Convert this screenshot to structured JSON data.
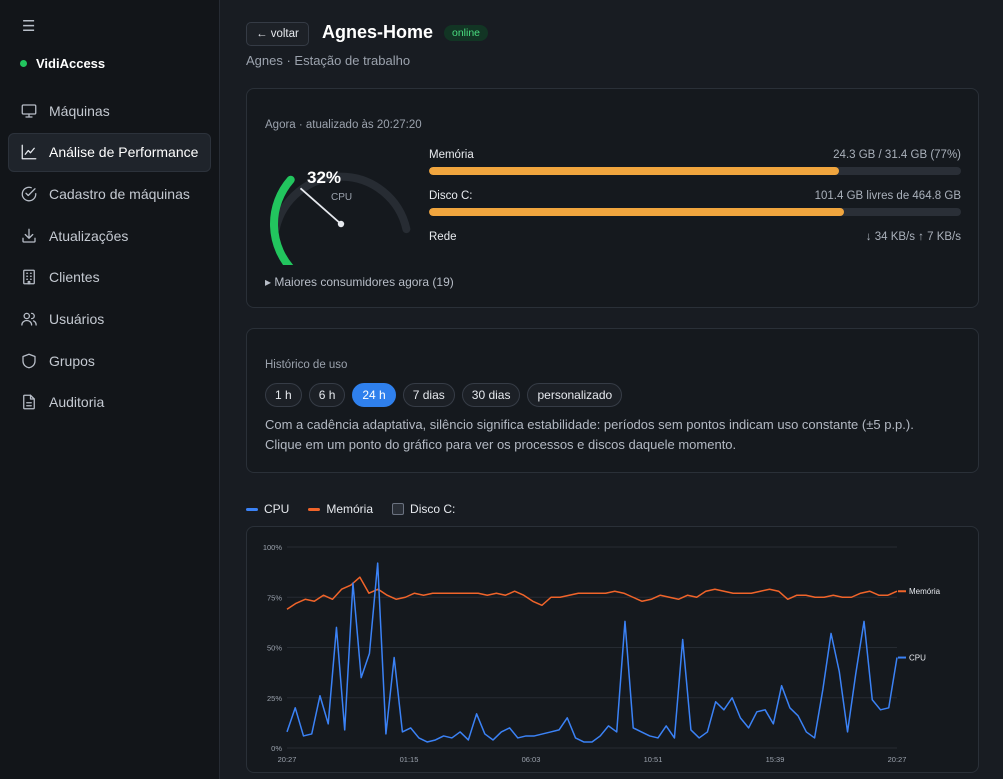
{
  "sidebar": {
    "menu_icon": "☰",
    "brand": "VidiAccess",
    "items": [
      {
        "label": "Máquinas",
        "icon": "monitor-icon"
      },
      {
        "label": "Análise de Performance",
        "icon": "chart-line-icon"
      },
      {
        "label": "Cadastro de máquinas",
        "icon": "check-circle-icon"
      },
      {
        "label": "Atualizações",
        "icon": "download-icon"
      },
      {
        "label": "Clientes",
        "icon": "building-icon"
      },
      {
        "label": "Usuários",
        "icon": "users-icon"
      },
      {
        "label": "Grupos",
        "icon": "shield-icon"
      },
      {
        "label": "Auditoria",
        "icon": "document-icon"
      }
    ],
    "active_index": 1
  },
  "header": {
    "back_label": "← voltar",
    "title": "Agnes-Home",
    "status": "online",
    "subtitle": "Agnes · Estação de trabalho"
  },
  "now": {
    "updated_label": "Agora · atualizado às 20:27:20",
    "cpu_value": "32%",
    "cpu_fraction": 0.32,
    "cpu_caption": "CPU",
    "memory": {
      "label": "Memória",
      "value": "24.3 GB / 31.4 GB (77%)",
      "fraction": 0.77
    },
    "disk": {
      "label": "Disco C:",
      "value": "101.4 GB livres de 464.8 GB",
      "fraction": 0.78
    },
    "network": {
      "label": "Rede",
      "value": "↓ 34 KB/s ↑ 7 KB/s"
    },
    "consumers": "▸ Maiores consumidores agora (19)"
  },
  "history": {
    "label": "Histórico de uso",
    "ranges": [
      "1 h",
      "6 h",
      "24 h",
      "7 dias",
      "30 dias",
      "personalizado"
    ],
    "active_range": 2,
    "description_1": "Com a cadência adaptativa, silêncio significa estabilidade: períodos sem pontos indicam uso constante (±5 p.p.).",
    "description_2": "Clique em um ponto do gráfico para ver os processos e discos daquele momento."
  },
  "legend": {
    "cpu": "CPU",
    "memory": "Memória",
    "disk": "Disco C:"
  },
  "colors": {
    "cpu": "#3b82f6",
    "memory": "#f0642a",
    "accent": "#2f80ed",
    "gauge": "#22c55e",
    "bar": "#f0a53e"
  },
  "chart_data": {
    "type": "line",
    "x": [
      "20:27",
      "01:15",
      "06:03",
      "10:51",
      "15:39",
      "20:27"
    ],
    "ylim": [
      0,
      100
    ],
    "yticks": [
      "100%",
      "75%",
      "50%",
      "25%",
      "0%"
    ],
    "grid": true,
    "series": [
      {
        "name": "Memória",
        "values": [
          69,
          72,
          74,
          73,
          76,
          74,
          79,
          81,
          85,
          77,
          79,
          76,
          74,
          75,
          77,
          76,
          77,
          77,
          77,
          77,
          77,
          77,
          76,
          77,
          76,
          78,
          76,
          73,
          71,
          75,
          75,
          76,
          77,
          77,
          77,
          77,
          78,
          77,
          75,
          73,
          74,
          76,
          75,
          74,
          76,
          75,
          78,
          79,
          78,
          77,
          77,
          77,
          78,
          79,
          78,
          74,
          76,
          76,
          75,
          75,
          76,
          75,
          75,
          77,
          78,
          76,
          76,
          78
        ]
      },
      {
        "name": "CPU",
        "values": [
          8,
          20,
          6,
          7,
          26,
          12,
          60,
          9,
          82,
          35,
          47,
          92,
          7,
          45,
          8,
          10,
          5,
          3,
          4,
          6,
          5,
          8,
          4,
          17,
          7,
          4,
          8,
          10,
          5,
          6,
          6,
          7,
          8,
          9,
          15,
          5,
          3,
          3,
          6,
          11,
          8,
          63,
          10,
          8,
          6,
          5,
          11,
          5,
          54,
          9,
          5,
          8,
          23,
          19,
          25,
          15,
          10,
          18,
          19,
          12,
          31,
          20,
          16,
          8,
          5,
          29,
          57,
          38,
          8,
          37,
          63,
          24,
          19,
          20,
          45
        ]
      }
    ]
  }
}
